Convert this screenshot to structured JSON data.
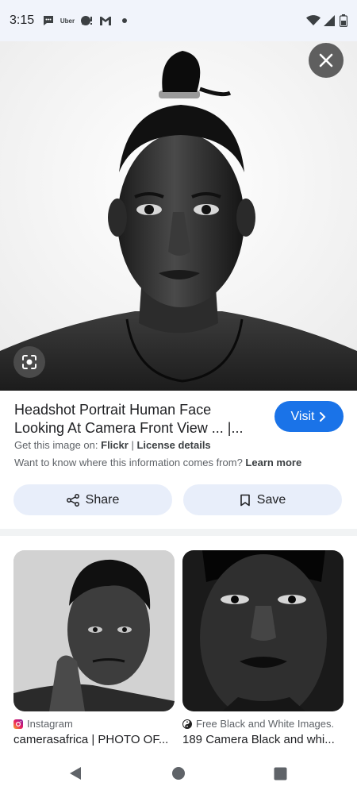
{
  "status_bar": {
    "time": "3:15",
    "notification_icons": [
      "chat-icon",
      "uber-icon",
      "messenger-icon",
      "gmail-icon",
      "dot-icon"
    ],
    "uber_label": "Uber",
    "system_icons": [
      "wifi-icon",
      "signal-icon",
      "battery-icon"
    ]
  },
  "viewer": {
    "close_icon": "close-icon",
    "lens_icon": "lens-icon"
  },
  "result": {
    "title": "Headshot Portrait Human Face Looking At Camera Front View ... |...",
    "visit_label": "Visit",
    "source_prefix": "Get this image on:",
    "source_name": "Flickr",
    "separator": "|",
    "license_label": "License details",
    "info_text": "Want to know where this information comes from?",
    "learn_more": "Learn more",
    "share_label": "Share",
    "save_label": "Save"
  },
  "related": [
    {
      "source": "Instagram",
      "source_icon": "instagram-icon",
      "title": "camerasafrica | PHOTO OF..."
    },
    {
      "source": "Free Black and White Images.",
      "source_icon": "yin-yang-icon",
      "title": "189 Camera Black and whi..."
    }
  ],
  "nav": {
    "icons": [
      "back-icon",
      "home-icon",
      "recents-icon"
    ]
  },
  "colors": {
    "accent": "#1a73e8",
    "pill": "#e8eefa",
    "status_bg": "#f1f4fb"
  }
}
